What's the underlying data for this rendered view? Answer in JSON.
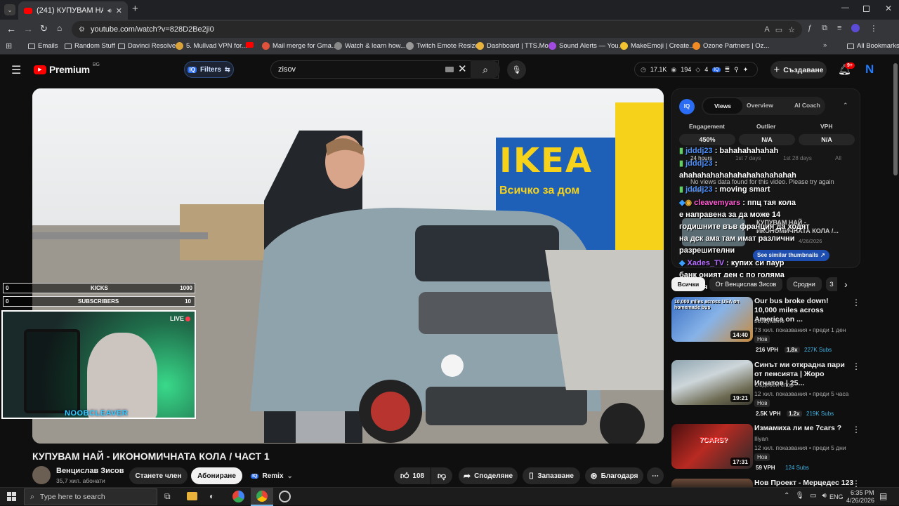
{
  "browser": {
    "tab_title": "(241) КУПУВАМ НАЙ - ИКО",
    "url": "youtube.com/watch?v=828D2Be2ji0",
    "bookmarks": [
      "Emails",
      "Random Stuff",
      "Davinci Resolve",
      "5. Mullvad VPN for...",
      "Mail merge for Gma...",
      "Watch & learn how...",
      "Twitch Emote Resizer",
      "Dashboard | TTS.Mo...",
      "Sound Alerts — You...",
      "MakeEmoji | Create...",
      "Ozone Partners | Oz..."
    ],
    "all_bookmarks": "All Bookmarks"
  },
  "youtube": {
    "logo": "Premium",
    "logo_region": "BG",
    "filters_label": "Filters",
    "search_value": "zisov",
    "stats": {
      "views": "17.1K",
      "watching": "194",
      "likes": "4"
    },
    "create_label": "Създаване",
    "notif_count": "9+",
    "avatar_letter": "N"
  },
  "video": {
    "title": "КУПУВАМ НАЙ - ИКОНОМИЧНАТА КОЛА / ЧАСТ 1",
    "channel": "Венцислав Зисов",
    "subscribers": "35,7 хил. абонати",
    "join_label": "Станете член",
    "subscribe_label": "Абониране",
    "remix_label": "Remix",
    "likes": "108",
    "share_label": "Споделяне",
    "save_label": "Запазване",
    "thanks_label": "Благодаря",
    "sign_text": "IKEA",
    "sign_sub": "Всичко за дом"
  },
  "stream_overlay": {
    "kicks_label": "KICKS",
    "kicks_value": "0",
    "kicks_goal": "1000",
    "subs_label": "SUBSCRIBERS",
    "subs_value": "0",
    "subs_goal": "10",
    "live_label": "LIVE",
    "streamer": "NOOBCLEAVER"
  },
  "iq_panel": {
    "logo": "IQ",
    "tabs": [
      "Views",
      "Overview",
      "AI Coach"
    ],
    "metrics": [
      {
        "label": "Engagement",
        "value": "450%"
      },
      {
        "label": "Outlier",
        "value": "N/A"
      },
      {
        "label": "VPH",
        "value": "N/A"
      }
    ],
    "ranges": [
      "24 hours",
      "1st 7 days",
      "1st 28 days",
      "All"
    ],
    "no_data": "No views data found for this video. Please try again later.",
    "thumb_title": "КУПУВАМ НАЙ - ИКОНОМИЧНАТА КОЛА /...",
    "thumb_date": "4/26/2026",
    "similar_label": "See similar thumbnails"
  },
  "chat": [
    {
      "name": "jdddj23",
      "text": "bahahahahahah"
    },
    {
      "name": "jdddj23",
      "text": ""
    },
    {
      "name": "",
      "text": "ahahahahahahahahahahahahah"
    },
    {
      "name": "jdddj23",
      "text": "moving smart"
    },
    {
      "name": "cleavemyars",
      "text": "ппц тая кола"
    },
    {
      "name": "",
      "text": "е направена за да може 14"
    },
    {
      "name": "",
      "text": "годишните във франция да ходят"
    },
    {
      "name": "",
      "text": "на дск ама там имат различни"
    },
    {
      "name": "",
      "text": "разрешителни"
    },
    {
      "name": "Xades_TV",
      "text": "купих си паур"
    },
    {
      "name": "",
      "text": "банк оният ден с по голяма"
    },
    {
      "name": "",
      "text": "батерия"
    }
  ],
  "rec_chips": [
    "Всички",
    "От Венцислав Зисов",
    "Сродни",
    "З"
  ],
  "recommendations": [
    {
      "title": "Our bus broke down! 10,000 miles across America on ...",
      "channel": "scottyfaimo",
      "meta": "73 хил. показвания • преди 1 ден",
      "badge": "Нов",
      "vph": "216 VPH",
      "mult": "1.8x",
      "subs": "227K Subs",
      "duration": "14:40",
      "thumb_text": "10,000 miles across USA on homemade bus"
    },
    {
      "title": "Синът ми открадна пари от пенсията | Жоро Игнатов | 25...",
      "channel": "Съдебен спор",
      "meta": "12 хил. показвания • преди 5 часа",
      "badge": "Нов",
      "vph": "2.5K VPH",
      "mult": "1.2x",
      "subs": "219K Subs",
      "duration": "19:21",
      "thumb_text": ""
    },
    {
      "title": "Измамиха ли ме 7cars ?",
      "channel": "Iliyan",
      "meta": "12 хил. показвания • преди 5 дни",
      "badge": "Нов",
      "vph": "59 VPH",
      "mult": "",
      "subs": "124 Subs",
      "duration": "17:31",
      "thumb_text": "7CARS?"
    },
    {
      "title": "Нов Проект - Мерцедес 123",
      "channel": "",
      "meta": "",
      "badge": "",
      "vph": "",
      "mult": "",
      "subs": "",
      "duration": "",
      "thumb_text": ""
    }
  ],
  "taskbar": {
    "search_placeholder": "Type here to search",
    "lang": "ENG",
    "time": "6:35 PM",
    "date": "4/26/2026"
  }
}
